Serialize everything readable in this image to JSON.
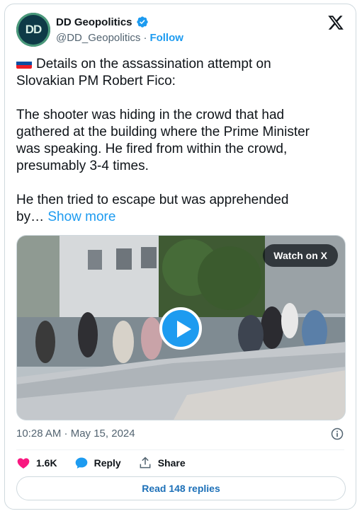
{
  "author": {
    "name": "DD Geopolitics",
    "handle": "@DD_Geopolitics",
    "separator": "·",
    "follow_label": "Follow",
    "avatar_text": "DD"
  },
  "tweet": {
    "line1": "Details on the assassination attempt on\nSlovakian PM Robert Fico:",
    "para2": "The shooter was hiding in the crowd that had\ngathered at the building where the Prime Minister\nwas speaking. He fired from within the crowd,\npresumably 3-4 times.",
    "para3": "He then tried to escape but was apprehended\nby…",
    "show_more": "Show more"
  },
  "media": {
    "watch_label": "Watch on X"
  },
  "timestamp": "10:28 AM · May 15, 2024",
  "actions": {
    "likes": "1.6K",
    "reply_label": "Reply",
    "share_label": "Share"
  },
  "replies_button": "Read 148 replies",
  "colors": {
    "accent": "#1d9bf0",
    "like": "#f91880"
  }
}
